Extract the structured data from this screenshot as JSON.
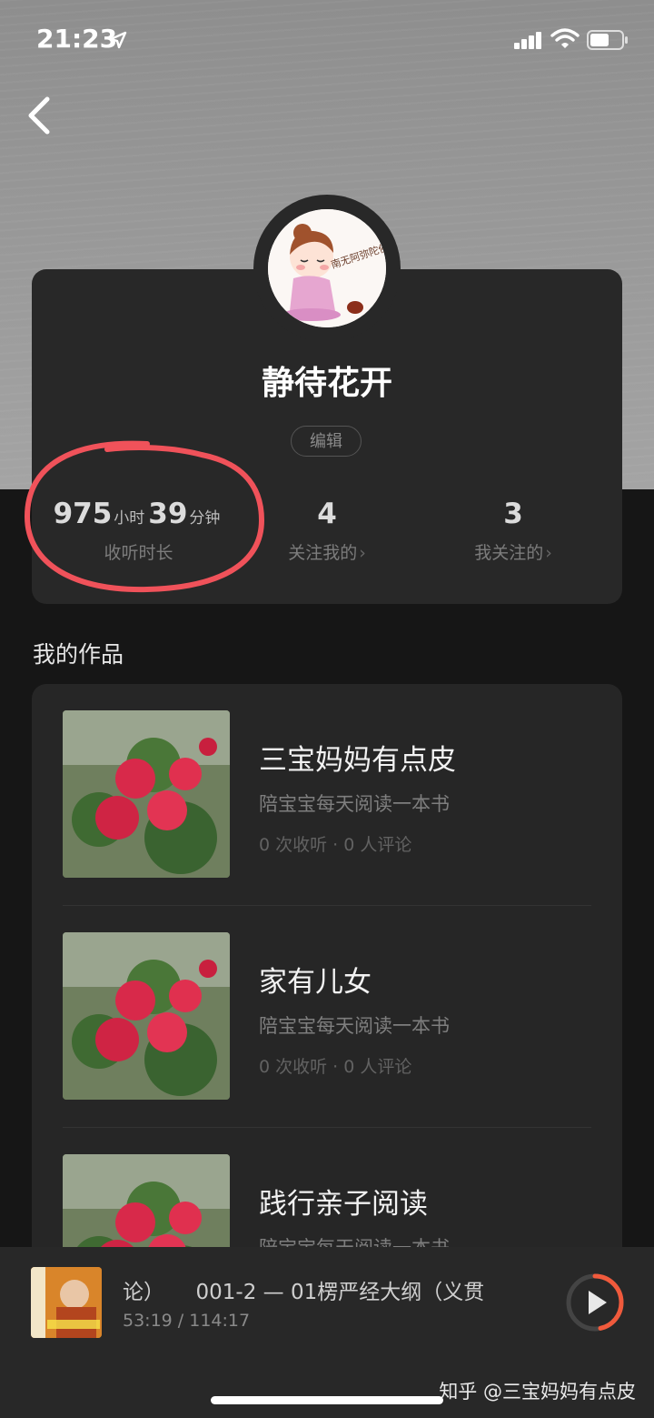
{
  "status_bar": {
    "time": "21:23"
  },
  "profile": {
    "name": "静待花开",
    "edit_label": "编辑",
    "avatar_text": "南无阿弥陀佛",
    "stats": {
      "listen_hours": "975",
      "listen_hours_unit": "小时",
      "listen_minutes": "39",
      "listen_minutes_unit": "分钟",
      "listen_label": "收听时长",
      "followers_count": "4",
      "followers_label": "关注我的",
      "following_count": "3",
      "following_label": "我关注的"
    }
  },
  "works": {
    "section_title": "我的作品",
    "items": [
      {
        "title": "三宝妈妈有点皮",
        "subtitle": "陪宝宝每天阅读一本书",
        "stats": "0  次收听 · 0  人评论"
      },
      {
        "title": "家有儿女",
        "subtitle": "陪宝宝每天阅读一本书",
        "stats": "0  次收听 · 0  人评论"
      },
      {
        "title": "践行亲子阅读",
        "subtitle": "陪宝宝每天阅读一本书",
        "stats": ""
      }
    ]
  },
  "player": {
    "title": "论）　　001-2 — 01楞严经大纲（义贯",
    "time": "53:19 / 114:17",
    "progress": 0.466
  },
  "watermark": "知乎 @三宝妈妈有点皮",
  "colors": {
    "background": "#161616",
    "card": "#282828",
    "highlight_ring": "#f0525a",
    "player_progress": "#f05a3c"
  }
}
